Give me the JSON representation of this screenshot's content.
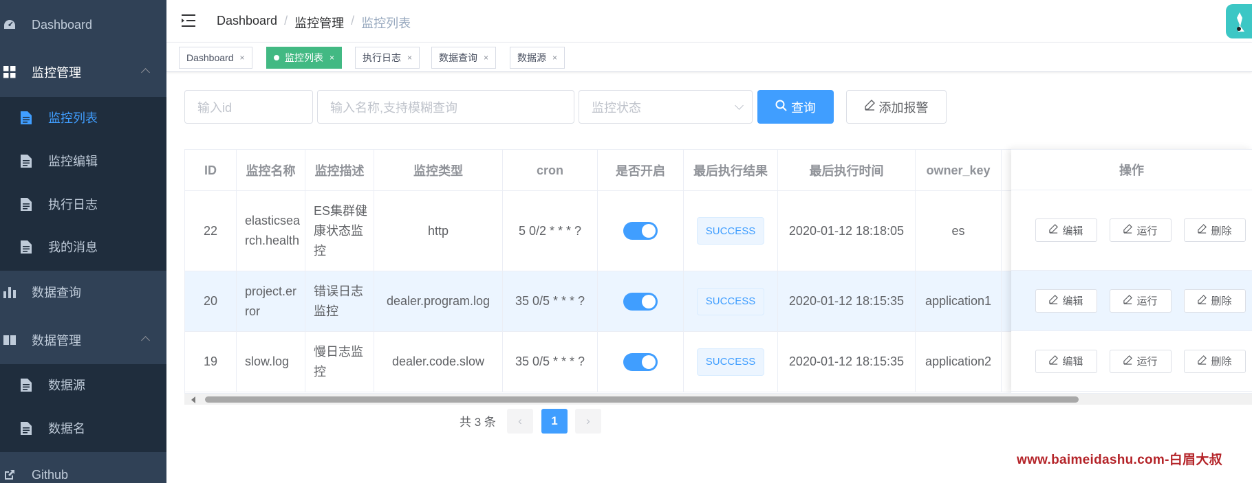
{
  "sidebar": {
    "dashboard": "Dashboard",
    "monitor_mgmt": "监控管理",
    "monitor_list": "监控列表",
    "monitor_edit": "监控编辑",
    "exec_log": "执行日志",
    "my_messages": "我的消息",
    "data_query": "数据查询",
    "data_mgmt": "数据管理",
    "data_source": "数据源",
    "data_name": "数据名",
    "github": "Github"
  },
  "breadcrumb": [
    "Dashboard",
    "/",
    "监控管理",
    "/",
    "监控列表"
  ],
  "tags": [
    "Dashboard",
    "监控列表",
    "执行日志",
    "数据查询",
    "数据源"
  ],
  "tag_close": "×",
  "filter": {
    "id_placeholder": "输入id",
    "name_placeholder": "输入名称,支持模糊查询",
    "status_placeholder": "监控状态",
    "query_button": "查询",
    "add_button": "添加报警"
  },
  "table": {
    "headers": [
      "ID",
      "监控名称",
      "监控描述",
      "监控类型",
      "cron",
      "是否开启",
      "最后执行结果",
      "最后执行时间",
      "owner_key",
      "操作"
    ],
    "rows": [
      {
        "id": "22",
        "name": "elasticsearch.health",
        "desc": "ES集群健康状态监控",
        "type": "http",
        "cron": "5 0/2 * * * ?",
        "enabled": true,
        "result": "SUCCESS",
        "time": "2020-01-12 18:18:05",
        "owner": "es"
      },
      {
        "id": "20",
        "name": "project.error",
        "desc": "错误日志监控",
        "type": "dealer.program.log",
        "cron": "35 0/5 * * * ?",
        "enabled": true,
        "result": "SUCCESS",
        "time": "2020-01-12 18:15:35",
        "owner": "application1"
      },
      {
        "id": "19",
        "name": "slow.log",
        "desc": "慢日志监控",
        "type": "dealer.code.slow",
        "cron": "35 0/5 * * * ?",
        "enabled": true,
        "result": "SUCCESS",
        "time": "2020-01-12 18:15:35",
        "owner": "application2"
      }
    ],
    "ops": {
      "edit": "编辑",
      "run": "运行",
      "delete": "删除"
    }
  },
  "pagination": {
    "total": "共 3 条",
    "current_page": "1",
    "prev": "‹",
    "next": "›"
  },
  "watermark": "www.baimeidashu.com-白眉大叔",
  "colors": {
    "sidebar": "#304156",
    "primary": "#409eff",
    "tag_active": "#42b983",
    "submenu": "#1f2d3d"
  }
}
